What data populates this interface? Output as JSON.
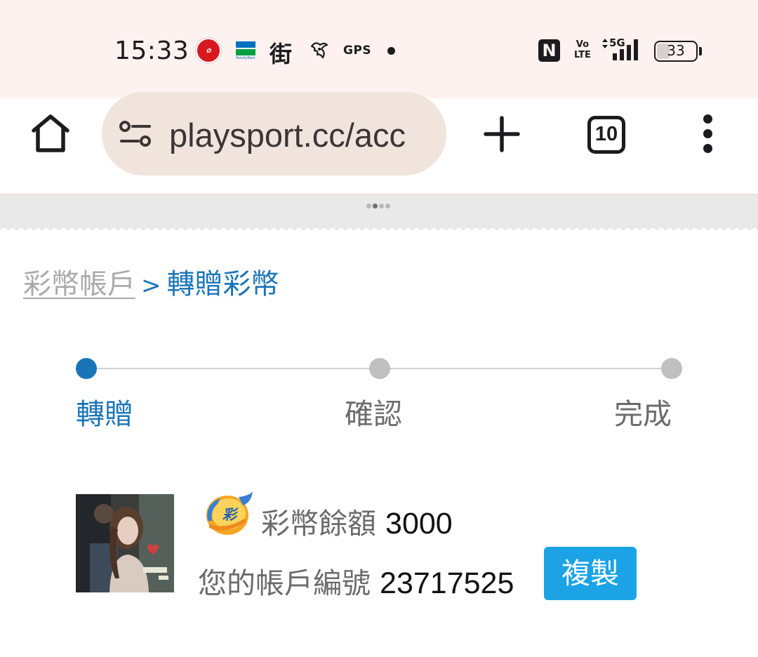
{
  "status_bar": {
    "time": "15:33",
    "icons": [
      "app-badge-icon",
      "familymart-icon",
      "street-icon",
      "bird-icon",
      "gps-icon",
      "dot-icon",
      "nfc-icon",
      "volte-icon",
      "5g-signal-icon",
      "battery-icon"
    ],
    "street_glyph": "街",
    "gps_label": "GPS",
    "nfc_glyph": "N",
    "volte_top": "Vo",
    "volte_bottom": "LTE",
    "network": "5G",
    "battery_level": "33"
  },
  "browser": {
    "url": "playsport.cc/acc",
    "tab_count": "10"
  },
  "breadcrumb": {
    "parent": "彩幣帳戶",
    "separator": ">",
    "current": "轉贈彩幣"
  },
  "stepper": {
    "steps": [
      {
        "label": "轉贈",
        "active": true
      },
      {
        "label": "確認",
        "active": false
      },
      {
        "label": "完成",
        "active": false
      }
    ]
  },
  "account": {
    "coin_badge_text": "彩",
    "balance_label": "彩幣餘額",
    "balance_value": "3000",
    "id_label": "您的帳戶編號",
    "id_value": "23717525",
    "copy_label": "複製"
  },
  "colors": {
    "accent_blue": "#1a75b8",
    "copy_button": "#1ba3e6",
    "toolbar_bg": "#fdf2ef",
    "url_pill_bg": "#f1e4dd"
  }
}
